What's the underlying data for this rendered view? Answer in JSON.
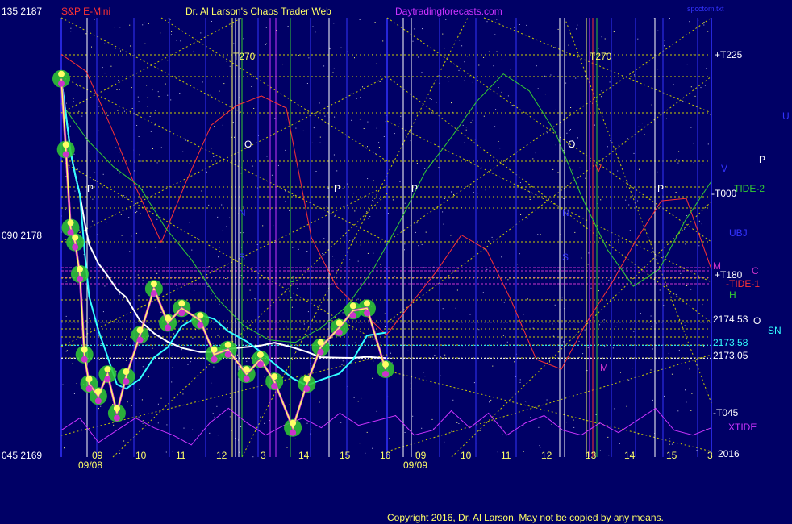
{
  "header": {
    "left_price_top": "135  2187",
    "symbol": "S&P E-Mini",
    "title": "Dr. Al Larson's Chaos Trader Web",
    "site": "Daytradingforecasts.com",
    "file": "spcctom.txt"
  },
  "footer": {
    "copyright": "Copyright 2016, Dr. Al Larson. May not be copied by any means."
  },
  "y_axis": {
    "labels": [
      {
        "text": "135  2187",
        "value": 2187
      },
      {
        "text": "090  2178",
        "value": 2178
      },
      {
        "text": "045  2169",
        "value": 2169
      }
    ]
  },
  "x_axis": {
    "hours": [
      "09",
      "10",
      "11",
      "12",
      "13",
      "14",
      "15",
      "16",
      "09",
      "10",
      "11",
      "12",
      "13",
      "14",
      "15",
      "16"
    ],
    "hour_digit_13": "3",
    "day1": "09/08",
    "day2": "09/09",
    "year": "2016"
  },
  "right_labels": {
    "t225": "+T225",
    "t000": "-T000",
    "tide2": "TIDE-2",
    "t180": "+T180",
    "tide1": "-TIDE-1",
    "t045": "-T045",
    "xtide": "XTIDE",
    "m": "M",
    "c": "C",
    "h": "H",
    "ubj": "UBJ",
    "v": "V",
    "p": "P",
    "u": "U",
    "o": "O",
    "sn": "SN",
    "p2174_53": "2174.53",
    "p2173_58": "2173.58",
    "p2173_05": "2173.05"
  },
  "in_chart_labels": {
    "t270_1": "T270",
    "t270_2": "T270",
    "o1": "O",
    "o2": "O",
    "n1": "N",
    "n2": "N",
    "s1": "S",
    "s2": "S",
    "p1": "P",
    "p2": "P",
    "p3": "P",
    "p4": "P",
    "j": "J",
    "m": "M",
    "v": "V"
  },
  "colors": {
    "background": "#000066",
    "price": "#ffff66",
    "average_white": "#ffffff",
    "average_cyan": "#33ffff",
    "tide1": "#ff3333",
    "tide2": "#33cc33",
    "xtide": "#cc33ff",
    "grid_yellow": "#cccc00",
    "level_purple": "#cc33cc",
    "axis_blue": "#3333ff"
  },
  "chart_data": {
    "type": "line",
    "title": "S&P E-Mini",
    "ylim": [
      2169,
      2187
    ],
    "levels": [
      {
        "name": "2174.53",
        "value": 2174.53
      },
      {
        "name": "2173.58",
        "value": 2173.58
      },
      {
        "name": "2173.05",
        "value": 2173.05
      }
    ],
    "series": [
      {
        "name": "S&P E-Mini",
        "session": "09/08",
        "x": [
          9.0,
          9.1,
          9.2,
          9.3,
          9.4,
          9.5,
          9.6,
          9.8,
          10.0,
          10.2,
          10.4,
          10.7,
          11.0,
          11.3,
          11.6,
          12.0,
          12.3,
          12.6,
          13.0,
          13.3,
          13.6,
          14.0,
          14.3,
          14.6,
          15.0,
          15.3,
          15.6,
          16.0
        ],
        "values": [
          2184.5,
          2181.6,
          2178.4,
          2177.8,
          2176.5,
          2173.2,
          2172.0,
          2171.5,
          2172.4,
          2170.8,
          2172.3,
          2174.0,
          2175.9,
          2174.5,
          2175.1,
          2174.6,
          2173.2,
          2173.4,
          2172.4,
          2173.0,
          2172.1,
          2170.2,
          2172.0,
          2173.5,
          2174.3,
          2175.0,
          2175.1,
          2172.6
        ]
      },
      {
        "name": "TIDE-1",
        "values": [
          2185.5,
          2184.8,
          2182.5,
          2180.0,
          2177.8,
          2180.3,
          2182.6,
          2183.4,
          2183.8,
          2183.3,
          2178.0,
          2176.0,
          2175.0,
          2174.0,
          2175.3,
          2176.6,
          2178.1,
          2177.5,
          2175.4,
          2173.0,
          2172.6,
          2174.5,
          2176.1,
          2177.9,
          2179.5,
          2179.6,
          2176.7
        ]
      },
      {
        "name": "TIDE-2",
        "values": [
          2183.5,
          2182.0,
          2180.9,
          2180.1,
          2178.4,
          2177.1,
          2175.5,
          2174.4,
          2173.8,
          2173.7,
          2174.3,
          2175.2,
          2176.7,
          2178.6,
          2180.7,
          2182.1,
          2183.6,
          2184.7,
          2184.0,
          2182.3,
          2179.7,
          2177.5,
          2176.0,
          2176.7,
          2178.7,
          2180.3
        ]
      },
      {
        "name": "XTIDE",
        "values": [
          2170.1,
          2170.6,
          2169.6,
          2170.1,
          2170.6,
          2170.2,
          2169.9,
          2169.5,
          2170.4,
          2171.0,
          2170.4,
          2169.9,
          2170.3,
          2170.6,
          2170.2,
          2170.8,
          2170.3,
          2170.5,
          2170.7,
          2169.9,
          2170.1,
          2170.9,
          2170.2,
          2170.8,
          2169.9,
          2170.4,
          2170.7,
          2170.1,
          2169.9,
          2170.4,
          2170.0,
          2170.5,
          2171.0,
          2170.1,
          2169.9,
          2170.2
        ]
      }
    ]
  }
}
